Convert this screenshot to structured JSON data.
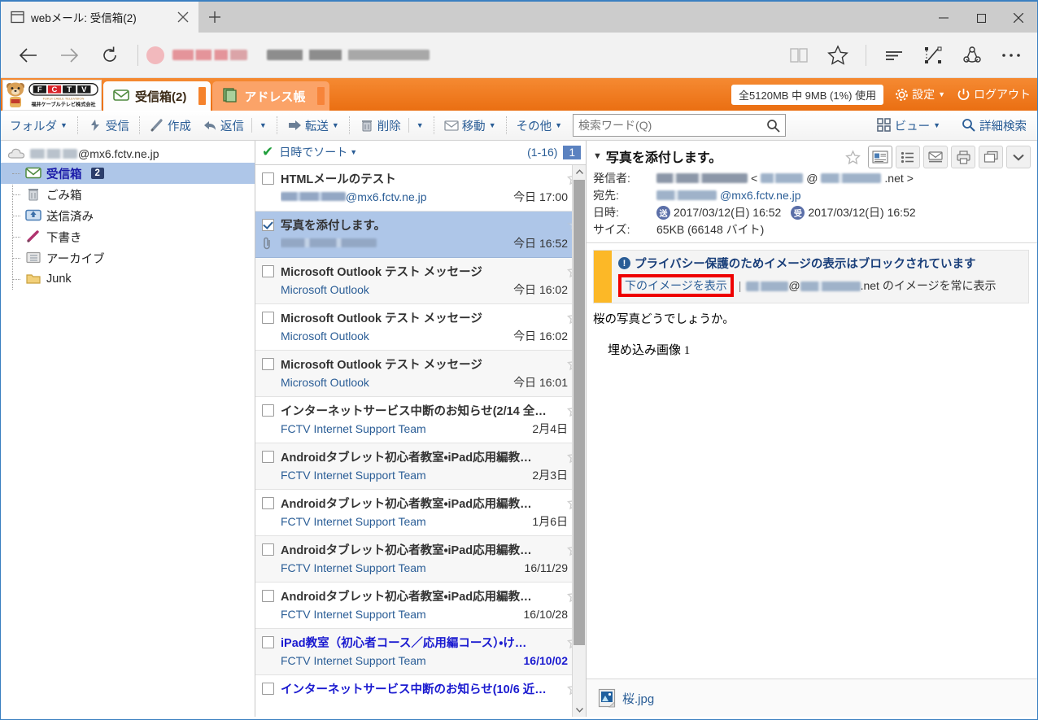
{
  "browser": {
    "tab": {
      "title": "webメール: 受信箱(2)",
      "favicon": "window-icon",
      "close": "×"
    },
    "new_tab": "+",
    "window_controls": {
      "minimize": "–",
      "maximize": "□",
      "close": "✕"
    },
    "nav": {
      "back": "←",
      "forward": "→",
      "refresh": "⟳"
    },
    "address_value": "",
    "toolbar_icons": [
      "reading-view-icon",
      "favorites-star-icon",
      "hub-icon",
      "web-note-icon",
      "share-icon",
      "more-icon"
    ]
  },
  "app_header": {
    "logo_alt": "FCTV 福井ケーブルテレビ株式会社",
    "logo_text": "FCTV",
    "tabs": [
      {
        "label": "受信箱(2)",
        "icon": "inbox-icon",
        "active": true
      },
      {
        "label": "アドレス帳",
        "icon": "addressbook-icon",
        "active": false
      }
    ],
    "quota": "全5120MB 中 9MB (1%) 使用",
    "settings": "設定",
    "logout": "ログアウト"
  },
  "toolbar": {
    "folder": "フォルダ",
    "receive": "受信",
    "compose": "作成",
    "reply": "返信",
    "forward": "転送",
    "delete": "削除",
    "move": "移動",
    "other": "その他",
    "search_placeholder": "検索ワード(Q)",
    "search_value": "",
    "view": "ビュー",
    "advanced_search": "詳細検索"
  },
  "sidebar": {
    "account": "@mx6.fctv.ne.jp",
    "folders": [
      {
        "label": "受信箱",
        "icon": "inbox-icon",
        "count": "2",
        "selected": true
      },
      {
        "label": "ごみ箱",
        "icon": "trash-icon",
        "count": "",
        "selected": false
      },
      {
        "label": "送信済み",
        "icon": "sent-icon",
        "count": "",
        "selected": false
      },
      {
        "label": "下書き",
        "icon": "draft-pencil-icon",
        "count": "",
        "selected": false
      },
      {
        "label": "アーカイブ",
        "icon": "archive-folder-icon",
        "count": "",
        "selected": false
      },
      {
        "label": "Junk",
        "icon": "folder-icon",
        "count": "",
        "selected": false
      }
    ]
  },
  "list": {
    "sort_label": "日時でソート",
    "range": "(1-16)",
    "page": "1",
    "messages": [
      {
        "subject": "HTMLメールのテスト",
        "sender": "@mx6.fctv.ne.jp",
        "sender_redacted": true,
        "date": "今日 17:00",
        "checked": false,
        "selected": false,
        "unread": false,
        "attachment": false
      },
      {
        "subject": "写真を添付します。",
        "sender": "",
        "sender_redacted": true,
        "date": "今日 16:52",
        "checked": true,
        "selected": true,
        "unread": false,
        "attachment": true
      },
      {
        "subject": "Microsoft Outlook テスト メッセージ",
        "sender": "Microsoft Outlook",
        "sender_redacted": false,
        "date": "今日 16:02",
        "checked": false,
        "selected": false,
        "unread": false,
        "attachment": false
      },
      {
        "subject": "Microsoft Outlook テスト メッセージ",
        "sender": "Microsoft Outlook",
        "sender_redacted": false,
        "date": "今日 16:02",
        "checked": false,
        "selected": false,
        "unread": false,
        "attachment": false
      },
      {
        "subject": "Microsoft Outlook テスト メッセージ",
        "sender": "Microsoft Outlook",
        "sender_redacted": false,
        "date": "今日 16:01",
        "checked": false,
        "selected": false,
        "unread": false,
        "attachment": false
      },
      {
        "subject": "インターネットサービス中断のお知らせ(2/14 全…",
        "sender": "FCTV Internet Support Team",
        "sender_redacted": false,
        "date": "2月4日",
        "checked": false,
        "selected": false,
        "unread": false,
        "attachment": false
      },
      {
        "subject": "Androidタブレット初心者教室・iPad応用編教…",
        "sender": "FCTV Internet Support Team",
        "sender_redacted": false,
        "date": "2月3日",
        "checked": false,
        "selected": false,
        "unread": false,
        "attachment": false
      },
      {
        "subject": "Androidタブレット初心者教室・iPad応用編教…",
        "sender": "FCTV Internet Support Team",
        "sender_redacted": false,
        "date": "1月6日",
        "checked": false,
        "selected": false,
        "unread": false,
        "attachment": false
      },
      {
        "subject": "Androidタブレット初心者教室・iPad応用編教…",
        "sender": "FCTV Internet Support Team",
        "sender_redacted": false,
        "date": "16/11/29",
        "checked": false,
        "selected": false,
        "unread": false,
        "attachment": false
      },
      {
        "subject": "Androidタブレット初心者教室・iPad応用編教…",
        "sender": "FCTV Internet Support Team",
        "sender_redacted": false,
        "date": "16/10/28",
        "checked": false,
        "selected": false,
        "unread": false,
        "attachment": false
      },
      {
        "subject": "iPad教室（初心者コース／応用編コース）・け…",
        "sender": "FCTV Internet Support Team",
        "sender_redacted": false,
        "date": "16/10/02",
        "checked": false,
        "selected": false,
        "unread": true,
        "attachment": false
      },
      {
        "subject": "インターネットサービス中断のお知らせ(10/6 近…",
        "sender": "",
        "sender_redacted": false,
        "date": "",
        "checked": false,
        "selected": false,
        "unread": true,
        "attachment": false
      }
    ]
  },
  "reading": {
    "subject": "写真を添付します。",
    "meta": {
      "from_label": "発信者:",
      "from_domain": ".net",
      "to_label": "宛先:",
      "to_value": "@mx6.fctv.ne.jp",
      "date_label": "日時:",
      "sent_badge": "送",
      "sent_value": "2017/03/12(日) 16:52",
      "recv_badge": "受",
      "recv_value": "2017/03/12(日) 16:52",
      "size_label": "サイズ:",
      "size_value": "65KB (66148 バイト)"
    },
    "actions": [
      "star-icon",
      "preview-pane-icon",
      "list-view-icon",
      "view-source-icon",
      "print-icon",
      "open-window-icon",
      "chevron-down-icon"
    ],
    "warning": {
      "title": "プライバシー保護のためイメージの表示はブロックされています",
      "show_images": "下のイメージを表示",
      "always_show_suffix": ".net のイメージを常に表示",
      "highlight_color": "#ee0000",
      "accent_color": "#fcb827"
    },
    "body_text": "桜の写真どうでしょうか。",
    "embedded_label": "埋め込み画像 1",
    "attachment": {
      "name": "桜.jpg",
      "icon": "image-file-icon"
    }
  }
}
